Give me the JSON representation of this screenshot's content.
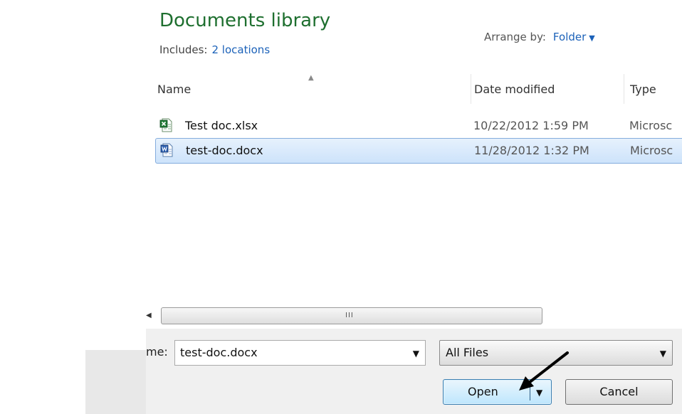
{
  "library": {
    "title": "Documents library",
    "includes_label": "Includes:",
    "includes_link": "2 locations",
    "arrange_label": "Arrange by:",
    "arrange_value": "Folder"
  },
  "columns": {
    "name": "Name",
    "date": "Date modified",
    "type": "Type"
  },
  "files": [
    {
      "name": "Test doc.xlsx",
      "date": "10/22/2012 1:59 PM",
      "type": "Microsc",
      "icon": "excel-file-icon",
      "selected": false
    },
    {
      "name": "test-doc.docx",
      "date": "11/28/2012 1:32 PM",
      "type": "Microsc",
      "icon": "word-file-icon",
      "selected": true
    }
  ],
  "scrollbar": {
    "grip": "III"
  },
  "bottom": {
    "file_name_label": "me:",
    "file_name_value": "test-doc.docx",
    "filter_value": "All Files",
    "open_label": "Open",
    "cancel_label": "Cancel"
  },
  "colors": {
    "title_green": "#1e6f2f",
    "link_blue": "#1c62b9",
    "selection_border": "#84acdd",
    "open_button_border": "#3c7fb1"
  }
}
